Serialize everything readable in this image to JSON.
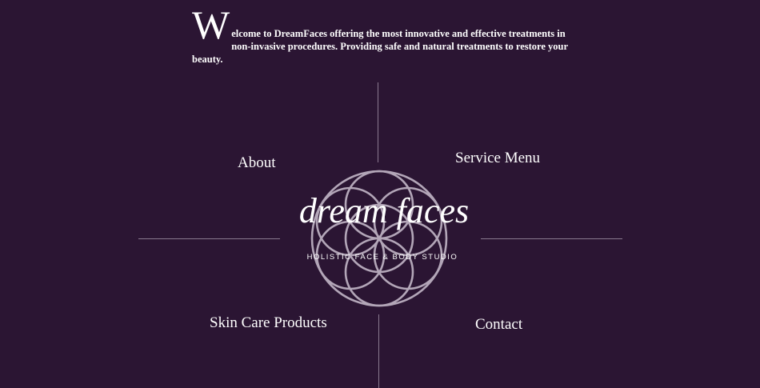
{
  "intro": {
    "dropcap": "W",
    "text": "elcome to DreamFaces offering the most innovative and effective treatments in non-invasive procedures. Providing safe and natural treatments to restore your beauty."
  },
  "nav": {
    "about": "About",
    "service_menu": "Service Menu",
    "skin_care": "Skin Care Products",
    "contact": "Contact"
  },
  "logo": {
    "script": "dream faces",
    "tagline": "HOLISTIC FACE & BODY STUDIO"
  },
  "colors": {
    "background": "#2b1533",
    "divider": "#8a7a90",
    "logo_circles": "#b3a6b8",
    "text": "#ffffff"
  }
}
